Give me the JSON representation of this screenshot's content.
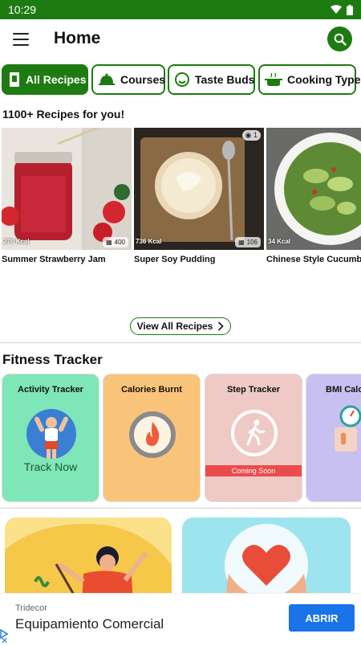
{
  "status_bar": {
    "time": "10:29"
  },
  "app_bar": {
    "title": "Home"
  },
  "chips": [
    {
      "label": "All Recipes",
      "active": true
    },
    {
      "label": "Courses",
      "active": false
    },
    {
      "label": "Taste Buds",
      "active": false
    },
    {
      "label": "Cooking Type",
      "active": false
    }
  ],
  "recipes_section": {
    "heading": "1100+ Recipes for you!",
    "items": [
      {
        "name": "Summer Strawberry Jam",
        "kcal": "276 Kcal",
        "count": "400"
      },
      {
        "name": "Super Soy Pudding",
        "kcal": "736 Kcal",
        "count": "106",
        "views": "1"
      },
      {
        "name": "Chinese Style Cucumber",
        "kcal": "34 Kcal"
      }
    ],
    "view_all": "View All Recipes"
  },
  "fitness_section": {
    "heading": "Fitness Tracker",
    "cards": [
      {
        "title": "Activity Tracker",
        "action": "Track Now",
        "color": "#7fe6b8"
      },
      {
        "title": "Calories Burnt",
        "color": "#f9c47a"
      },
      {
        "title": "Step Tracker",
        "badge": "Coming Soon",
        "color": "#efc9c6"
      },
      {
        "title": "BMI Calc",
        "color": "#c8c0f0"
      }
    ]
  },
  "ad": {
    "advertiser": "Tridecor",
    "headline": "Equipamiento Comercial",
    "cta": "ABRIR"
  },
  "colors": {
    "primary": "#1e7b12",
    "ad_button": "#1a73e8"
  }
}
